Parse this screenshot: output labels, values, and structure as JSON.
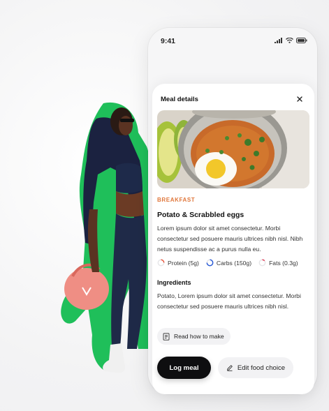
{
  "status_bar": {
    "time": "9:41",
    "icons": [
      "signal-icon",
      "wifi-icon",
      "battery-icon"
    ]
  },
  "modal": {
    "title": "Meal details",
    "close_icon": "close-icon"
  },
  "meal": {
    "image_alt": "meal-photo",
    "category": "BREAKFAST",
    "name": "Potato & Scrabbled eggs",
    "description": "Lorem ipsum dolor sit amet consectetur. Morbi consectetur sed posuere mauris ultrices nibh nisl. Nibh netus suspendisse ac a purus nulla eu.",
    "macros": [
      {
        "label": "Protein (5g)",
        "color": "#e8573f"
      },
      {
        "label": "Carbs (150g)",
        "color": "#2a5bd7"
      },
      {
        "label": "Fats (0.3g)",
        "color": "#e0455e"
      }
    ],
    "ingredients_title": "Ingredients",
    "ingredients": "Potato, Lorem ipsum dolor sit amet consectetur. Morbi consectetur sed posuere mauris ultrices nibh nisl."
  },
  "actions": {
    "read_label": "Read how to make",
    "log_label": "Log meal",
    "edit_label": "Edit food choice"
  },
  "colors": {
    "accent_orange": "#e0763a",
    "brand_green": "#1fbf5a",
    "button_dark": "#0e0e10"
  }
}
